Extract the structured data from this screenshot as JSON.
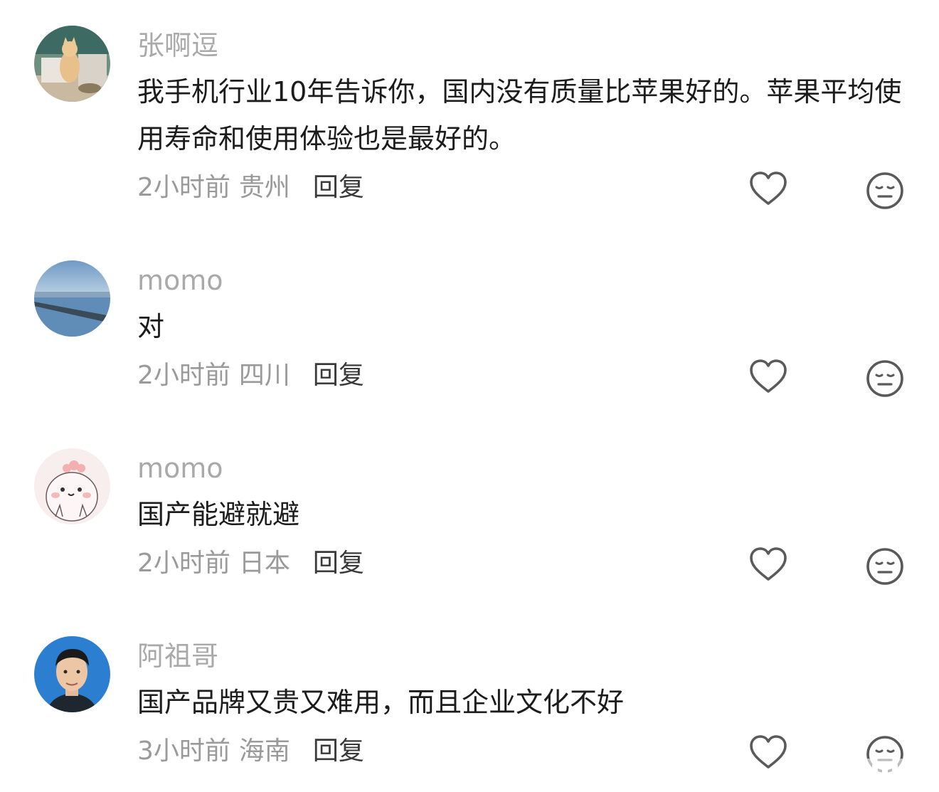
{
  "comments": [
    {
      "username": "张啊逗",
      "text": "我手机行业10年告诉你，国内没有质量比苹果好的。苹果平均使用寿命和使用体验也是最好的。",
      "time": "2小时前",
      "location": "贵州",
      "reply_label": "回复"
    },
    {
      "username": "momo",
      "text": "对",
      "time": "2小时前",
      "location": "四川",
      "reply_label": "回复"
    },
    {
      "username": "momo",
      "text": "国产能避就避",
      "time": "2小时前",
      "location": "日本",
      "reply_label": "回复"
    },
    {
      "username": "阿祖哥",
      "text": "国产品牌又贵又难用，而且企业文化不好",
      "time": "3小时前",
      "location": "海南",
      "reply_label": "回复"
    }
  ],
  "icons": {
    "like": "heart-icon",
    "dislike": "neutral-face-icon"
  },
  "colors": {
    "username": "#a9a9a9",
    "text": "#1c1c1c",
    "meta": "#9a9a9a",
    "icon": "#5a5a5a"
  }
}
